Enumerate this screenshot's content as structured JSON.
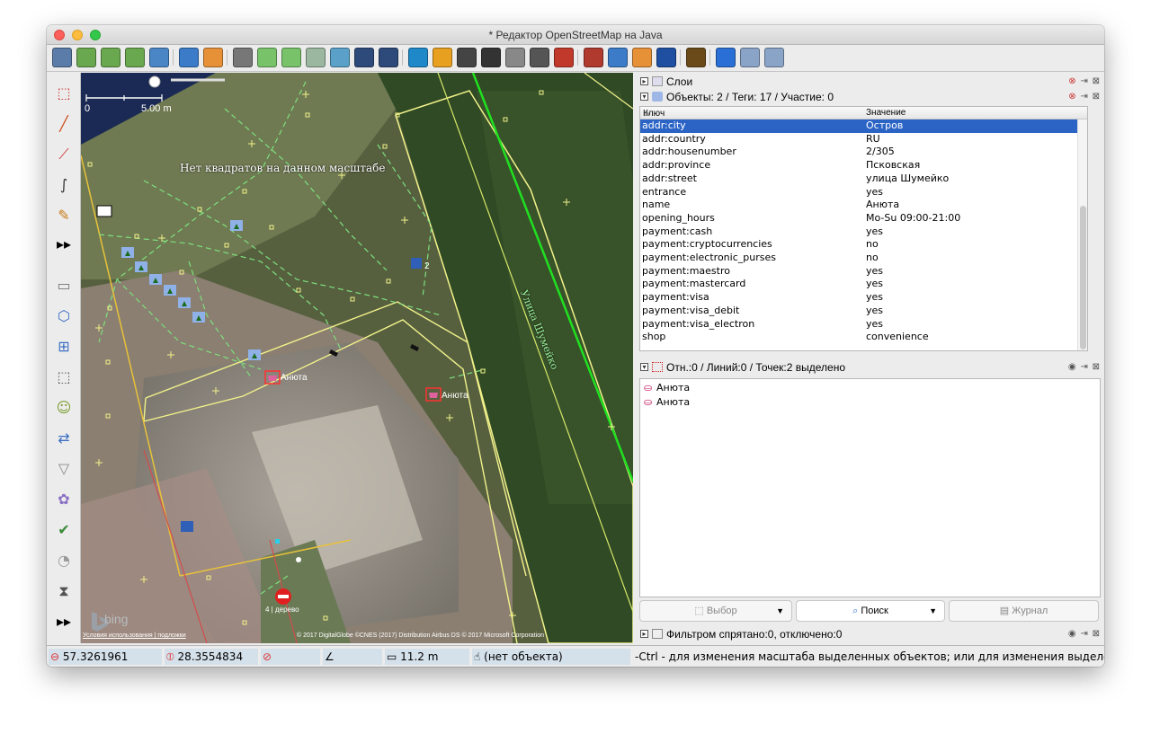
{
  "window": {
    "title": "* Редактор OpenStreetMap на Java"
  },
  "toolbar": {
    "icons": [
      "open-icon",
      "download-icon",
      "download-object-icon",
      "download-area-icon",
      "upload-icon",
      "preferences-icon",
      "undo-icon",
      "redo-icon",
      "zoom-to-data-icon",
      "zoom-to-selection-icon",
      "wms-layer-icon",
      "zoom-icon",
      "imagery-1-icon",
      "imagery-2-icon",
      "bing-icon",
      "road-icon",
      "wall-icon",
      "gate-icon",
      "fence-icon",
      "light-icon",
      "brick-icon",
      "railway-icon",
      "bed-icon",
      "beer-icon",
      "info-icon",
      "factory-icon",
      "river-icon",
      "search-image-icon",
      "search-image2-icon"
    ]
  },
  "left_tools": {
    "icons": [
      "select-tool-icon",
      "draw-tool-icon",
      "improve-way-icon",
      "parallel-way-icon",
      "draw-pencil-icon",
      "more-tools-icon",
      "layers-toggle-icon",
      "tags-toggle-icon",
      "relations-toggle-icon",
      "selection-list-icon",
      "author-icon",
      "conflict-icon",
      "filter-icon",
      "map-paint-icon",
      "validator-icon",
      "notes-icon",
      "history-icon",
      "more-tools2-icon"
    ]
  },
  "map": {
    "scale_left": "0",
    "scale_right": "5.00 m",
    "no_tiles_message": "Нет квадратов на данном масштабе",
    "street_label": "Улица Шумейко",
    "parking_label": "2",
    "poi_label_1": "Анюта",
    "poi_label_2": "Анюта",
    "tree_label": "4 | дерево",
    "bing_logo": "bing",
    "terms_link": "Условия использования | подложки",
    "attribution": "© 2017 DigitalGlobe ©CNES (2017) Distribution Airbus DS © 2017 Microsoft Corporation"
  },
  "layers_panel": {
    "title": "Слои"
  },
  "tags_panel": {
    "title": "Объекты: 2 / Теги: 17 / Участие: 0",
    "col_key": "Ключ",
    "col_value": "Значение",
    "rows": [
      {
        "k": "addr:city",
        "v": "Остров"
      },
      {
        "k": "addr:country",
        "v": "RU"
      },
      {
        "k": "addr:housenumber",
        "v": "2/305"
      },
      {
        "k": "addr:province",
        "v": "Псковская"
      },
      {
        "k": "addr:street",
        "v": "улица Шумейко"
      },
      {
        "k": "entrance",
        "v": "yes"
      },
      {
        "k": "name",
        "v": "Анюта"
      },
      {
        "k": "opening_hours",
        "v": "Mo-Su 09:00-21:00"
      },
      {
        "k": "payment:cash",
        "v": "yes"
      },
      {
        "k": "payment:cryptocurrencies",
        "v": "no"
      },
      {
        "k": "payment:electronic_purses",
        "v": "no"
      },
      {
        "k": "payment:maestro",
        "v": "yes"
      },
      {
        "k": "payment:mastercard",
        "v": "yes"
      },
      {
        "k": "payment:visa",
        "v": "yes"
      },
      {
        "k": "payment:visa_debit",
        "v": "yes"
      },
      {
        "k": "payment:visa_electron",
        "v": "yes"
      },
      {
        "k": "shop",
        "v": "convenience"
      }
    ]
  },
  "selection_panel": {
    "title": "Отн.:0 / Линий:0 / Точек:2 выделено",
    "items": [
      "Анюта",
      "Анюта"
    ]
  },
  "buttons": {
    "select": "Выбор",
    "search": "Поиск",
    "history": "Журнал"
  },
  "filter_panel": {
    "title": "Фильтром спрятано:0, отключено:0"
  },
  "status": {
    "lat": "57.3261961",
    "lon": "28.3554834",
    "heading": "",
    "angle": "",
    "distance": "11.2 m",
    "object": "(нет объекта)",
    "help": "-Ctrl - для изменения масштаба выделенных объектов; или для изменения выделения"
  },
  "colors": {
    "selection": "#2c64c6",
    "way": "#f2f28a",
    "highlight": "#00ff00",
    "accent": "#fdbc40"
  }
}
